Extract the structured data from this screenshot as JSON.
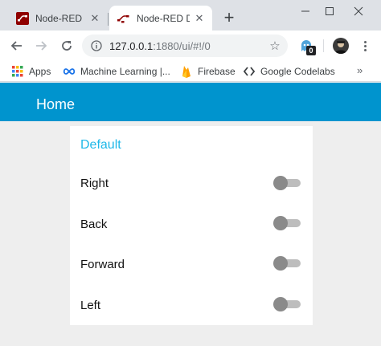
{
  "browser": {
    "tabs": [
      {
        "title": "Node-RED",
        "active": false
      },
      {
        "title": "Node-RED D",
        "active": true
      }
    ],
    "new_tab_symbol": "+",
    "address": {
      "host": "127.0.0.1",
      "rest": ":1880/ui/#!/0"
    },
    "extension_badge": "0",
    "bookmarks": [
      {
        "label": "Apps",
        "icon": "apps-grid-icon"
      },
      {
        "label": "Machine Learning |...",
        "icon": "infinity-icon"
      },
      {
        "label": "Firebase",
        "icon": "firebase-icon"
      },
      {
        "label": "Google Codelabs",
        "icon": "codelabs-icon"
      }
    ],
    "more_symbol": "»"
  },
  "dashboard": {
    "title": "Home",
    "group": {
      "name": "Default",
      "switches": [
        {
          "label": "Right",
          "on": false
        },
        {
          "label": "Back",
          "on": false
        },
        {
          "label": "Forward",
          "on": false
        },
        {
          "label": "Left",
          "on": false
        }
      ]
    }
  },
  "colors": {
    "header": "#0094ce",
    "group_title": "#1eb8e8",
    "switch_off_thumb": "#8a8a8a",
    "switch_off_track": "#bdbdbd"
  }
}
